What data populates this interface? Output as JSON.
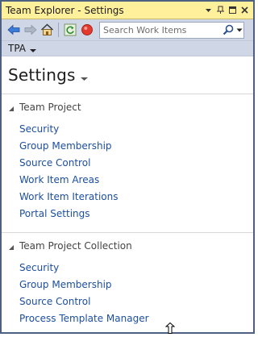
{
  "window": {
    "title": "Team Explorer - Settings",
    "controls": [
      "dropdown",
      "pin-icon",
      "restore-icon",
      "close-icon"
    ]
  },
  "toolbar": {
    "buttons": [
      "back-arrow-icon",
      "forward-arrow-icon",
      "home-icon",
      "refresh-icon",
      "stop-icon"
    ],
    "search_placeholder": "Search Work Items"
  },
  "project": {
    "name": "TPA"
  },
  "page": {
    "title": "Settings"
  },
  "sections": [
    {
      "title": "Team Project",
      "links": [
        "Security",
        "Group Membership",
        "Source Control",
        "Work Item Areas",
        "Work Item Iterations",
        "Portal Settings"
      ]
    },
    {
      "title": "Team Project Collection",
      "links": [
        "Security",
        "Group Membership",
        "Source Control",
        "Process Template Manager"
      ]
    }
  ],
  "colors": {
    "title_bar": "#fff09c",
    "toolbar": "#cfd6e5",
    "link": "#1c4fa0",
    "border": "#4d6082"
  }
}
